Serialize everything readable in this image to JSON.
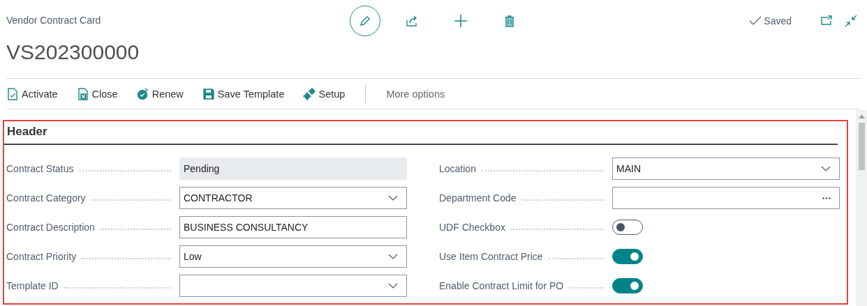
{
  "page": {
    "caption": "Vendor Contract Card",
    "title": "VS202300000",
    "status": "Saved"
  },
  "actions": [
    {
      "label": "Activate",
      "kind": "activate"
    },
    {
      "label": "Close",
      "kind": "close"
    },
    {
      "label": "Renew",
      "kind": "renew"
    },
    {
      "label": "Save Template",
      "kind": "save"
    },
    {
      "label": "Setup",
      "kind": "setup"
    }
  ],
  "more_options": "More options",
  "section": {
    "title": "Header",
    "left": [
      {
        "label": "Contract Status",
        "kind": "readonly",
        "value": "Pending"
      },
      {
        "label": "Contract Category",
        "kind": "dropdown",
        "value": "CONTRACTOR"
      },
      {
        "label": "Contract Description",
        "kind": "text",
        "value": "BUSINESS CONSULTANCY"
      },
      {
        "label": "Contract Priority",
        "kind": "dropdown",
        "value": "Low"
      },
      {
        "label": "Template ID",
        "kind": "dropdown"
      }
    ],
    "right": [
      {
        "label": "Location",
        "kind": "dropdown",
        "value": "MAIN"
      },
      {
        "label": "Department Code",
        "kind": "lookup"
      },
      {
        "label": "UDF Checkbox",
        "kind": "toggle",
        "on": false
      },
      {
        "label": "Use Item Contract Price",
        "kind": "toggle",
        "on": true
      },
      {
        "label": "Enable Contract Limit for PO",
        "kind": "toggle",
        "on": true
      }
    ]
  }
}
